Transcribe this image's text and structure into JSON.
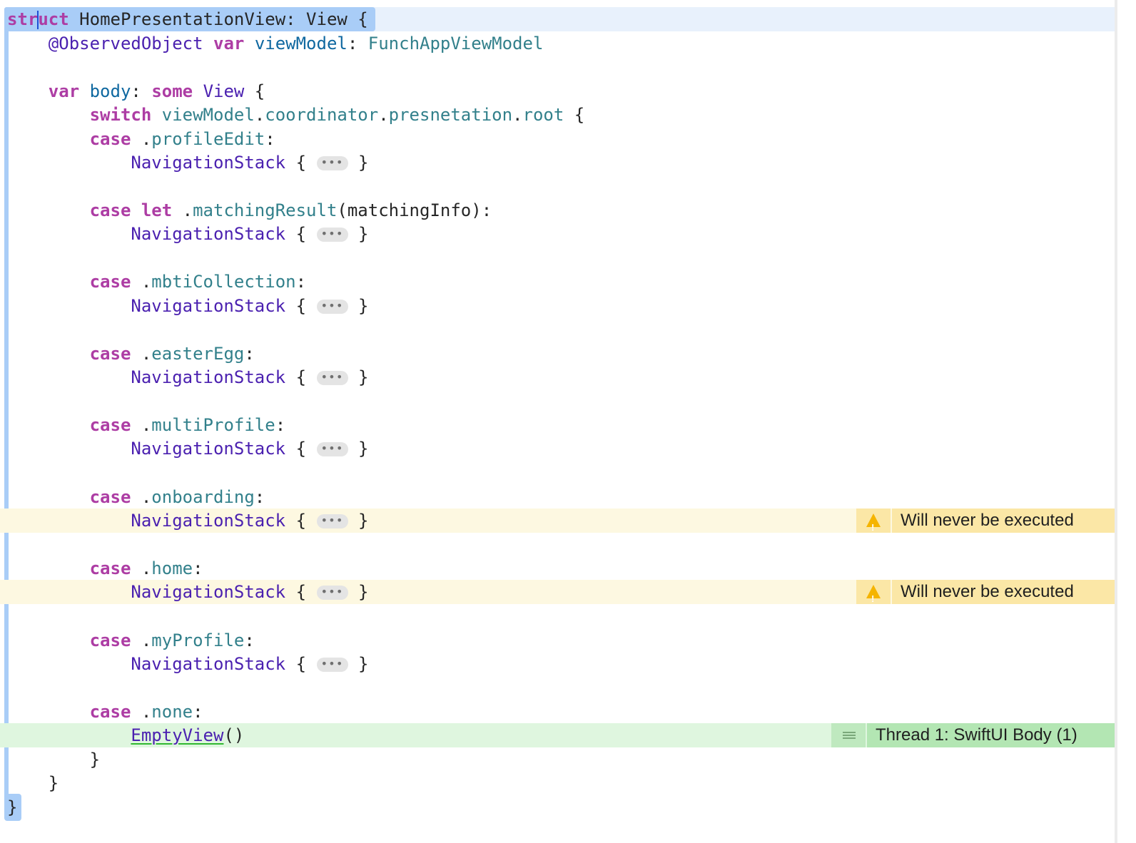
{
  "code": {
    "line1": {
      "kw": "struct",
      "name": " HomePresentationView: View {"
    },
    "line2": {
      "attr": "@ObservedObject",
      "kw": "var",
      "name": "viewModel",
      "type": "FunchAppViewModel"
    },
    "line4": {
      "kw1": "var",
      "name": "body",
      "kw2": "some",
      "type": "View"
    },
    "line5": {
      "kw": "switch",
      "path1": "viewModel",
      "path2": "coordinator",
      "path3": "presnetation",
      "path4": "root"
    },
    "cases": [
      {
        "label": "case",
        "extra": "",
        "name": "profileEdit",
        "suffix": ":"
      },
      {
        "label": "case",
        "extra": "let",
        "name": "matchingResult",
        "suffix": "(matchingInfo):"
      },
      {
        "label": "case",
        "extra": "",
        "name": "mbtiCollection",
        "suffix": ":"
      },
      {
        "label": "case",
        "extra": "",
        "name": "easterEgg",
        "suffix": ":"
      },
      {
        "label": "case",
        "extra": "",
        "name": "multiProfile",
        "suffix": ":"
      },
      {
        "label": "case",
        "extra": "",
        "name": "onboarding",
        "suffix": ":"
      },
      {
        "label": "case",
        "extra": "",
        "name": "home",
        "suffix": ":"
      },
      {
        "label": "case",
        "extra": "",
        "name": "myProfile",
        "suffix": ":"
      },
      {
        "label": "case",
        "extra": "",
        "name": "none",
        "suffix": ":"
      }
    ],
    "nav_stack": "NavigationStack",
    "fold_placeholder": "•••",
    "empty_view": "EmptyView",
    "empty_view_call": "()"
  },
  "issues": {
    "warning_1": "Will never be executed",
    "warning_2": "Will never be executed",
    "thread": "Thread 1: SwiftUI Body (1)"
  },
  "colors": {
    "keyword": "#ad3da4",
    "type": "#4b21b0",
    "property": "#32808b",
    "identifier": "#0f68a0",
    "warning_bg": "#fbe7a6",
    "thread_bg": "#b3e6b3",
    "scope_highlight": "#a9cdf7"
  },
  "icons": [
    "warning-icon",
    "thread-menu-icon"
  ]
}
